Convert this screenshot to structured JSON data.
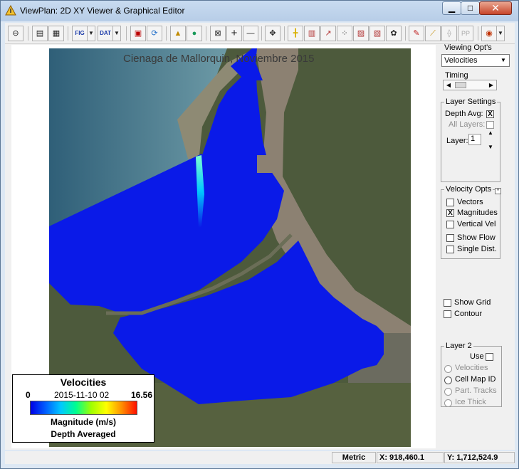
{
  "window": {
    "title": "ViewPlan: 2D XY Viewer & Graphical Editor",
    "controls": {
      "minimize": "▁",
      "maximize": "□",
      "close": "✕"
    }
  },
  "toolbar": {
    "buttons": [
      {
        "id": "tb-open",
        "icon": "globe-icon",
        "glyph": "⊖"
      },
      {
        "id": "tb-print",
        "icon": "printer-icon",
        "glyph": "▤"
      },
      {
        "id": "tb-copy",
        "icon": "copy-icon",
        "glyph": "▦"
      },
      {
        "id": "tb-fig",
        "icon": "fig-export-icon",
        "glyph": "FIG"
      },
      {
        "id": "tb-dat",
        "icon": "dat-export-icon",
        "glyph": "DAT"
      },
      {
        "id": "tb-save",
        "icon": "save-icon",
        "glyph": "▣"
      },
      {
        "id": "tb-refresh",
        "icon": "refresh-icon",
        "glyph": "⟳"
      },
      {
        "id": "tb-triangle",
        "icon": "triangle-icon",
        "glyph": "▲"
      },
      {
        "id": "tb-earth",
        "icon": "earth-icon",
        "glyph": "●"
      },
      {
        "id": "tb-zoom-in",
        "icon": "zoom-in-icon",
        "glyph": "⊠"
      },
      {
        "id": "tb-plus",
        "icon": "plus-icon",
        "glyph": "+"
      },
      {
        "id": "tb-minus",
        "icon": "minus-icon",
        "glyph": "—"
      },
      {
        "id": "tb-pan",
        "icon": "pan-icon",
        "glyph": "✥"
      },
      {
        "id": "tb-section",
        "icon": "section-icon",
        "glyph": "╋"
      },
      {
        "id": "tb-grid",
        "icon": "grid-icon",
        "glyph": "▥"
      },
      {
        "id": "tb-plot1",
        "icon": "plot-icon",
        "glyph": "↗"
      },
      {
        "id": "tb-plot2",
        "icon": "plot-points-icon",
        "glyph": "⁘"
      },
      {
        "id": "tb-plot3",
        "icon": "plot-chart-icon",
        "glyph": "▨"
      },
      {
        "id": "tb-plot4",
        "icon": "plot-bars-icon",
        "glyph": "▧"
      },
      {
        "id": "tb-film",
        "icon": "film-icon",
        "glyph": "✿"
      },
      {
        "id": "tb-pencil",
        "icon": "pencil-icon",
        "glyph": "✎"
      },
      {
        "id": "tb-brush",
        "icon": "brush-icon",
        "glyph": "⟋"
      },
      {
        "id": "tb-disabled1",
        "icon": "disabled-tool-icon",
        "glyph": "⟠"
      },
      {
        "id": "tb-pp",
        "icon": "pp-icon",
        "glyph": "PP"
      },
      {
        "id": "tb-target",
        "icon": "target-icon",
        "glyph": "◉"
      }
    ]
  },
  "map": {
    "title": "Cienaga de Mallorquin, Noviembre 2015"
  },
  "legend": {
    "title": "Velocities",
    "min": "0",
    "date": "2015-11-10 02",
    "max": "16.56",
    "magnitude_label": "Magnitude  (m/s)",
    "depth_label": "Depth Averaged"
  },
  "panel": {
    "viewing_opts": "Viewing Opt's",
    "viewing_select": "Velocities",
    "timing": "Timing",
    "layer_settings": {
      "title": "Layer Settings",
      "depth_avg": "Depth Avg:",
      "all_layers": "All Layers:",
      "layer_label": "Layer:",
      "layer_value": "1"
    },
    "velocity_opts": {
      "title": "Velocity Opts",
      "vectors": "Vectors",
      "magnitudes": "Magnitudes",
      "vertical_vel": "Vertical Vel",
      "show_flow": "Show Flow",
      "single_dist": "Single Dist."
    },
    "show_grid": "Show Grid",
    "contour": "Contour",
    "layer2": {
      "title": "Layer 2",
      "use": "Use",
      "velocities": "Velocities",
      "cell_map_id": "Cell Map ID",
      "part_tracks": "Part. Tracks",
      "ice_thick": "Ice Thick"
    },
    "checked_mark": "X"
  },
  "status": {
    "units": "Metric",
    "x": "X: 918,460.1",
    "y": "Y: 1,712,524.9"
  },
  "colors": {
    "water_blue": "#0a1ae8",
    "river": "#8c8172",
    "land": "#4d5a3c",
    "sea": "#3f6a80"
  }
}
